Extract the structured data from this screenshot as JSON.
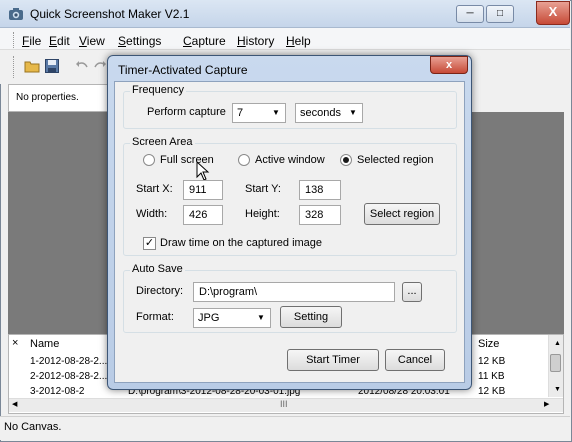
{
  "app": {
    "title": "Quick Screenshot Maker V2.1"
  },
  "menu": {
    "file": "File",
    "edit": "Edit",
    "view": "View",
    "settings": "Settings",
    "capture": "Capture",
    "history": "History",
    "help": "Help"
  },
  "properties": {
    "text": "No properties."
  },
  "list": {
    "col_name": "Name",
    "col_size": "Size",
    "rows": [
      {
        "name": "1-2012-08-28-2...",
        "path": "",
        "date": "",
        "size": "12 KB"
      },
      {
        "name": "2-2012-08-28-2...",
        "path": "",
        "date": "",
        "size": "11 KB"
      },
      {
        "name": "3-2012-08-2",
        "path": "D:\\program\\3-2012-08-28-20-03-01.jpg",
        "date": "2012/08/28 20:03:01",
        "size": "12 KB"
      }
    ],
    "scroll_mark": "III"
  },
  "status": {
    "text": "No Canvas."
  },
  "dialog": {
    "title": "Timer-Activated Capture",
    "close": "x",
    "frequency": {
      "label": "Frequency",
      "perform_label": "Perform capture",
      "interval_value": "7",
      "unit_value": "seconds"
    },
    "screen_area": {
      "label": "Screen Area",
      "options": [
        "Full screen",
        "Active window",
        "Selected region"
      ],
      "selected": "Selected region",
      "start_x_label": "Start X:",
      "start_x": "911",
      "start_y_label": "Start Y:",
      "start_y": "138",
      "width_label": "Width:",
      "width": "426",
      "height_label": "Height:",
      "height": "328",
      "select_region_button": "Select region",
      "draw_time_label": "Draw time on the captured image",
      "draw_time_checked": true
    },
    "auto_save": {
      "label": "Auto Save",
      "directory_label": "Directory:",
      "directory_value": "D:\\program\\",
      "browse_button": "...",
      "format_label": "Format:",
      "format_value": "JPG",
      "setting_button": "Setting"
    },
    "start_button": "Start Timer",
    "cancel_button": "Cancel"
  }
}
